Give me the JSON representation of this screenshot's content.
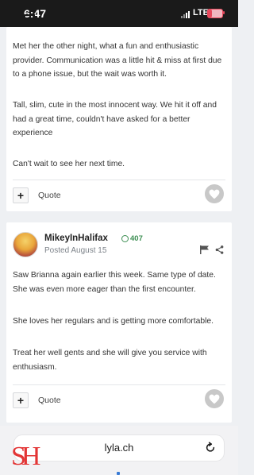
{
  "status_bar": {
    "time": "6:47",
    "network": "LTE"
  },
  "post1": {
    "paragraphs": [
      "Met her the other night, what a fun and enthusiastic provider.  Communication was a little hit & miss at first due to a phone issue, but the wait was worth it.",
      "Tall, slim,  cute in the most innocent way.  We hit it off and had a great time, couldn't have asked for a better experience",
      "Can't wait to see her next time."
    ],
    "quote_label": "Quote"
  },
  "post2": {
    "username": "MikeyInHalifax",
    "reputation": "407",
    "posted": "Posted August 15",
    "paragraphs": [
      "Saw Brianna again earlier this week. Same type of date. She was even more eager than the first encounter.",
      "She loves her regulars and is getting more comfortable.",
      "Treat her well gents and she will give you service with enthusiasm."
    ],
    "quote_label": "Quote"
  },
  "browser": {
    "url": "lyla.ch"
  },
  "watermark": {
    "logo_text": "SH"
  },
  "icons": {
    "plus": "plus-icon",
    "like": "heart-icon",
    "flag": "flag-icon",
    "share": "share-icon",
    "reload": "reload-icon"
  },
  "colors": {
    "reputation_green": "#3d8f53",
    "logo_red": "#e33535",
    "like_gray": "#c8c8c8"
  }
}
